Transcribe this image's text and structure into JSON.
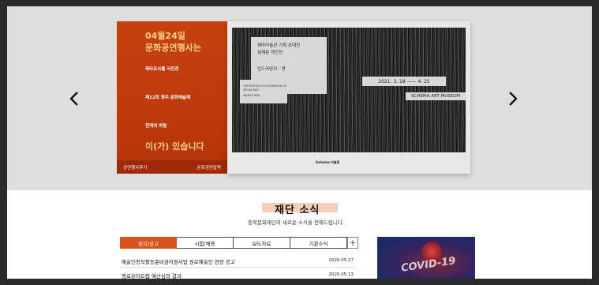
{
  "banner": {
    "prev_arrow": "‹",
    "next_arrow": "›",
    "card": {
      "date": "04월24일",
      "headline": "문화공연행사는",
      "items": [
        "육타프사롬 사진전",
        "제12회 청주 문화예술제",
        "천개의 바람"
      ],
      "tail": "이(가) 있습니다",
      "footer_left": "공연행사후기",
      "footer_right": "문화공연달력"
    },
    "poster": {
      "title_line1": "쉐마미술관 기획 초대전",
      "title_line2": "심재분 개인전",
      "title_line3": "인드라망라 : 연",
      "small_line1": "THE INVITED SOLO EXHIBITION OF",
      "small_line2": "SIM JAE BUN",
      "small_line3": "INDRA'S WEB",
      "dates": "2021. 3. 18  ——  4. 25",
      "museum": "SCHEMA ART MUSEUM",
      "logo": "Schema 미술관"
    }
  },
  "news": {
    "title": "재단 소식",
    "subtitle": "충북문화재단의 새로운 소식을 전해드립니다.",
    "tabs": [
      "공지/공고",
      "시험/채용",
      "보도자료",
      "기관소식"
    ],
    "plus": "+",
    "rows": [
      {
        "title": "예술인창작활동준비금지원사업 원로예술인 연장 공고",
        "date": "2020.05.17"
      },
      {
        "title": "행로유아트랩 예산심의 결과",
        "date": "2020.05.13"
      }
    ],
    "thumb_text": "COVID-19"
  },
  "colors": {
    "accent": "#d9531e",
    "card_bg": "#c6410f",
    "card_text_highlight": "#ffcf8a"
  }
}
